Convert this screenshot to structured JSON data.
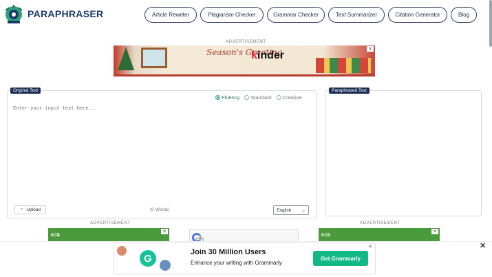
{
  "brand": {
    "name": "PARAPHRASER"
  },
  "nav": [
    {
      "label": "Article Rewriter"
    },
    {
      "label": "Plagiarism Checker"
    },
    {
      "label": "Grammar Checker"
    },
    {
      "label": "Text Summarizer"
    },
    {
      "label": "Citation Generator"
    },
    {
      "label": "Blog"
    }
  ],
  "ads": {
    "label": "ADVERTISEMENT",
    "top": {
      "greeting": "Season's Greeting",
      "brand_prefix": "k",
      "brand_rest": "inder",
      "close": "✕"
    },
    "kcb_label": "KCB"
  },
  "editor": {
    "original_tag": "Original Text",
    "paraphrased_tag": "Paraphrased Text",
    "modes": [
      {
        "label": "Fluency",
        "selected": true
      },
      {
        "label": "Standard",
        "selected": false
      },
      {
        "label": "Creative",
        "selected": false
      }
    ],
    "placeholder": "Enter your input text here...",
    "upload_label": "Upload",
    "word_count": "(0 Words)",
    "language": "English"
  },
  "grammarly": {
    "title": "Join 30 Million Users",
    "subtitle": "Enhance your writing with Grammarly",
    "cta": "Get Grammarly",
    "logo_letter": "G"
  },
  "colors": {
    "brand": "#1a3a6b",
    "accent": "#15c39a",
    "tag_bg": "#1d2f55"
  }
}
